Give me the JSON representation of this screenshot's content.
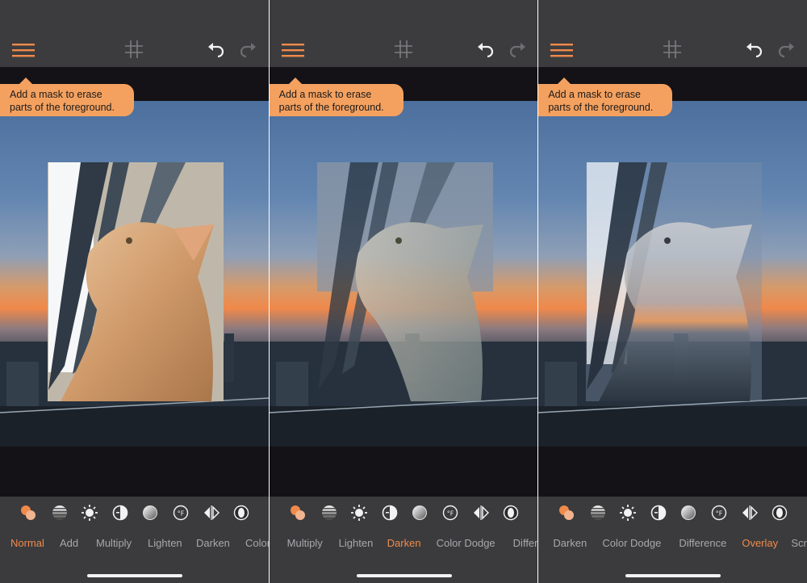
{
  "tooltip": {
    "line1": "Add a mask to erase",
    "line2": "parts of the foreground."
  },
  "colors": {
    "accent": "#f08a4b",
    "tooltip_bg": "#f4a160",
    "toolbar_bg": "#3b3b3d",
    "label_inactive": "#a8a8ac"
  },
  "toolbar_icons": [
    "layers-blend-icon",
    "stripes-icon",
    "brightness-icon",
    "contrast-icon",
    "gradient-circle-icon",
    "temperature-icon",
    "flip-icon",
    "vignette-icon"
  ],
  "panels": [
    {
      "blend_mode": "Normal",
      "labels": [
        "Normal",
        "Add",
        "Multiply",
        "Lighten",
        "Darken",
        "Color"
      ]
    },
    {
      "blend_mode": "Darken",
      "labels": [
        "Multiply",
        "Lighten",
        "Darken",
        "Color Dodge",
        "Differe"
      ]
    },
    {
      "blend_mode": "Overlay",
      "labels": [
        "Darken",
        "Color Dodge",
        "Difference",
        "Overlay",
        "Scre"
      ]
    }
  ]
}
